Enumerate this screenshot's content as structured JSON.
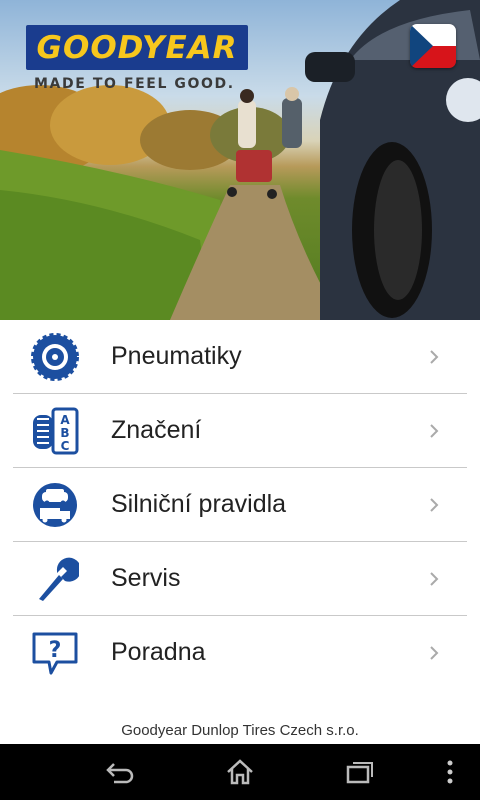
{
  "header": {
    "brand": "GOODYEAR",
    "tagline": "MADE TO FEEL GOOD.",
    "language_flag_icon": "czech-flag-icon"
  },
  "menu": {
    "items": [
      {
        "label": "Pneumatiky",
        "icon": "tire-icon"
      },
      {
        "label": "Značení",
        "icon": "tire-abc-icon"
      },
      {
        "label": "Silniční pravidla",
        "icon": "car-truck-icon"
      },
      {
        "label": "Servis",
        "icon": "wrench-icon"
      },
      {
        "label": "Poradna",
        "icon": "question-bubble-icon"
      }
    ]
  },
  "footer": {
    "company": "Goodyear Dunlop Tires Czech s.r.o."
  },
  "colors": {
    "icon_blue": "#1c4fa0",
    "brand_blue": "#1a3c8e",
    "brand_yellow": "#f7c71d",
    "divider": "#c9c9c9"
  },
  "navbar": {
    "buttons": [
      "back-icon",
      "home-icon",
      "recent-apps-icon",
      "overflow-menu-icon"
    ]
  }
}
